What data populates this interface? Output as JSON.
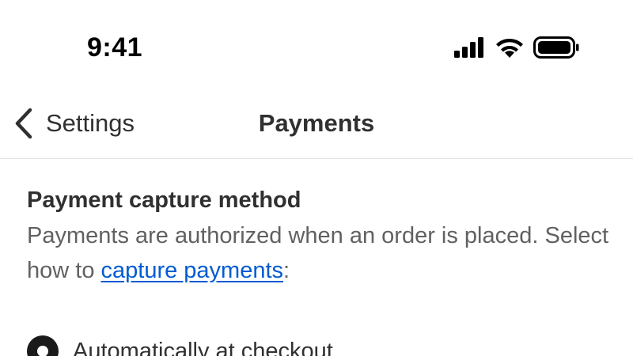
{
  "status_bar": {
    "time": "9:41",
    "icons": [
      "cellular-signal-icon",
      "wifi-icon",
      "battery-icon"
    ]
  },
  "nav": {
    "back_label": "Settings",
    "title": "Payments"
  },
  "section": {
    "title": "Payment capture method",
    "desc_before": "Payments are authorized when an order is placed. Select how to ",
    "link_text": "capture payments",
    "desc_after": ":"
  },
  "options": [
    {
      "label": "Automatically at checkout",
      "selected": true
    }
  ],
  "colors": {
    "link": "#005bd3",
    "text_primary": "#303030",
    "text_secondary": "#616161",
    "divider": "#e3e3e3"
  }
}
